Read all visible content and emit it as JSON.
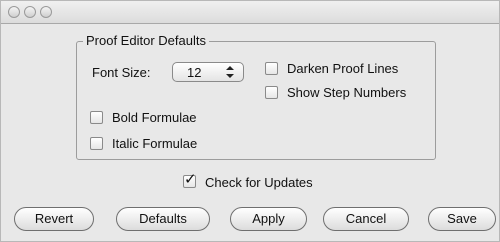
{
  "group": {
    "title": "Proof Editor Defaults"
  },
  "font_size": {
    "label": "Font Size:",
    "value": "12"
  },
  "options": {
    "darken_proof_lines": {
      "label": "Darken Proof Lines",
      "checked": false
    },
    "show_step_numbers": {
      "label": "Show Step Numbers",
      "checked": false
    },
    "bold_formulae": {
      "label": "Bold Formulae",
      "checked": false
    },
    "italic_formulae": {
      "label": "Italic Formulae",
      "checked": false
    }
  },
  "check_updates": {
    "label": "Check for Updates",
    "checked": true,
    "glyph": "✓"
  },
  "buttons": {
    "revert": "Revert",
    "defaults": "Defaults",
    "apply": "Apply",
    "cancel": "Cancel",
    "save": "Save"
  },
  "icons": {
    "window_controls": [
      "close-icon",
      "minimize-icon",
      "zoom-icon"
    ],
    "stepper": "up-down-arrows-icon",
    "checkmark": "checkmark-icon"
  }
}
